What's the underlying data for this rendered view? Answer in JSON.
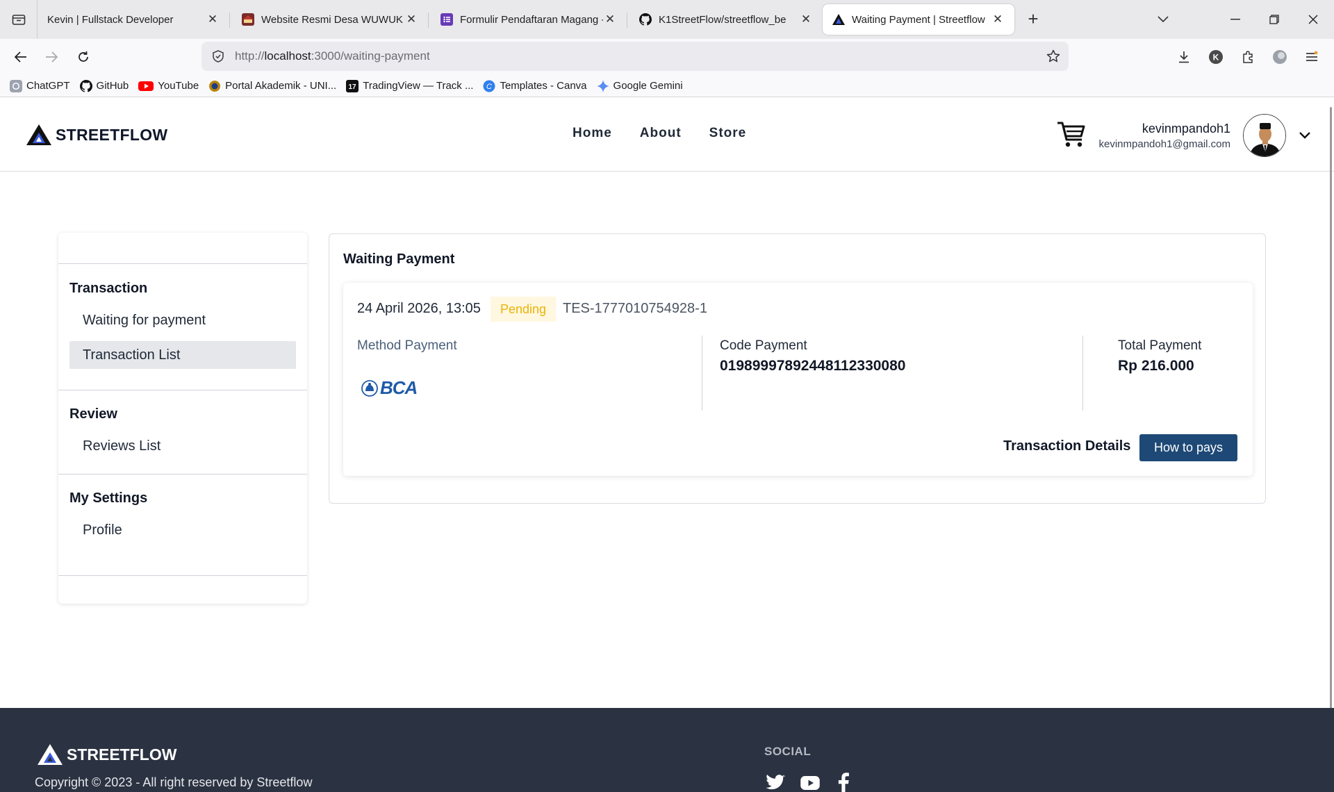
{
  "browser": {
    "tabs": [
      {
        "title": "Kevin | Fullstack Developer",
        "active": false
      },
      {
        "title": "Website Resmi Desa WUWUK",
        "active": false
      },
      {
        "title": "Formulir Pendaftaran Magang -",
        "active": false
      },
      {
        "title": "K1StreetFlow/streetflow_be",
        "active": false
      },
      {
        "title": "Waiting Payment | Streetflow",
        "active": true
      }
    ],
    "url_host": "localhost",
    "url_prefix": "http://",
    "url_path": ":3000/waiting-payment",
    "bookmarks": [
      "ChatGPT",
      "GitHub",
      "YouTube",
      "Portal Akademik - UNI...",
      "TradingView — Track ...",
      "Templates - Canva",
      "Google Gemini"
    ]
  },
  "header": {
    "brand": "STREETFLOW",
    "nav": [
      "Home",
      "About",
      "Store"
    ],
    "user_name": "kevinmpandoh1",
    "user_email": "kevinmpandoh1@gmail.com"
  },
  "sidebar": {
    "sections": [
      {
        "title": "Transaction",
        "items": [
          "Waiting for payment",
          "Transaction List"
        ]
      },
      {
        "title": "Review",
        "items": [
          "Reviews List"
        ]
      },
      {
        "title": "My Settings",
        "items": [
          "Profile"
        ]
      }
    ],
    "active_item": "Transaction List"
  },
  "main": {
    "title": "Waiting Payment",
    "order": {
      "date": "24 April 2026, 13:05",
      "status": "Pending",
      "ref": "TES-1777010754928-1",
      "method_label": "Method Payment",
      "method_brand": "BCA",
      "code_label": "Code Payment",
      "code_value": "01989997892448112330080",
      "total_label": "Total Payment",
      "total_value": "Rp 216.000",
      "details_label": "Transaction Details",
      "how_button": "How to pays"
    }
  },
  "footer": {
    "brand": "STREETFLOW",
    "copyright": "Copyright © 2023 - All right reserved by Streetflow",
    "social_title": "SOCIAL",
    "social_icons": [
      "twitter-icon",
      "youtube-icon",
      "facebook-icon"
    ]
  },
  "colors": {
    "accent": "#1e4976",
    "pending_text": "#eab308",
    "pending_bg": "#fff7e0",
    "footer_bg": "#2b3241"
  }
}
